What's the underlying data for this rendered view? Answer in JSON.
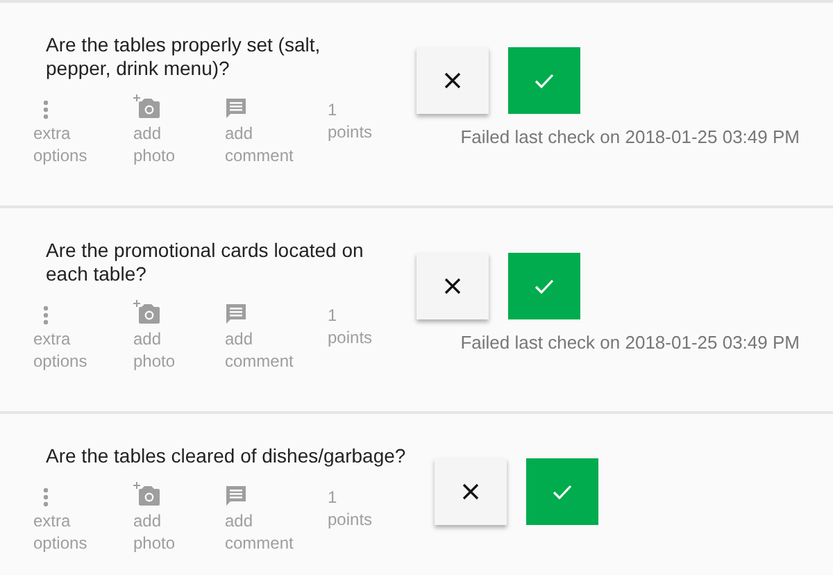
{
  "checks": [
    {
      "question": "Are the tables properly set (salt, pepper, drink menu)?",
      "actions": [
        {
          "kind": "menu",
          "label": "extra options"
        },
        {
          "kind": "photo",
          "label": "add photo"
        },
        {
          "kind": "comment",
          "label": "add comment"
        }
      ],
      "points_value": "1",
      "points_label": "points",
      "passed": true,
      "status": "Failed last check on 2018-01-25 03:49 PM"
    },
    {
      "question": "Are the promotional cards located on each table?",
      "actions": [
        {
          "kind": "menu",
          "label": "extra options"
        },
        {
          "kind": "photo",
          "label": "add photo"
        },
        {
          "kind": "comment",
          "label": "add comment"
        }
      ],
      "points_value": "1",
      "points_label": "points",
      "passed": true,
      "status": "Failed last check on 2018-01-25 03:49 PM"
    },
    {
      "question": "Are the tables cleared of dishes/garbage?",
      "actions": [
        {
          "kind": "menu",
          "label": "extra options"
        },
        {
          "kind": "photo",
          "label": "add photo"
        },
        {
          "kind": "comment",
          "label": "add comment"
        }
      ],
      "points_value": "1",
      "points_label": "points",
      "passed": true
    }
  ]
}
